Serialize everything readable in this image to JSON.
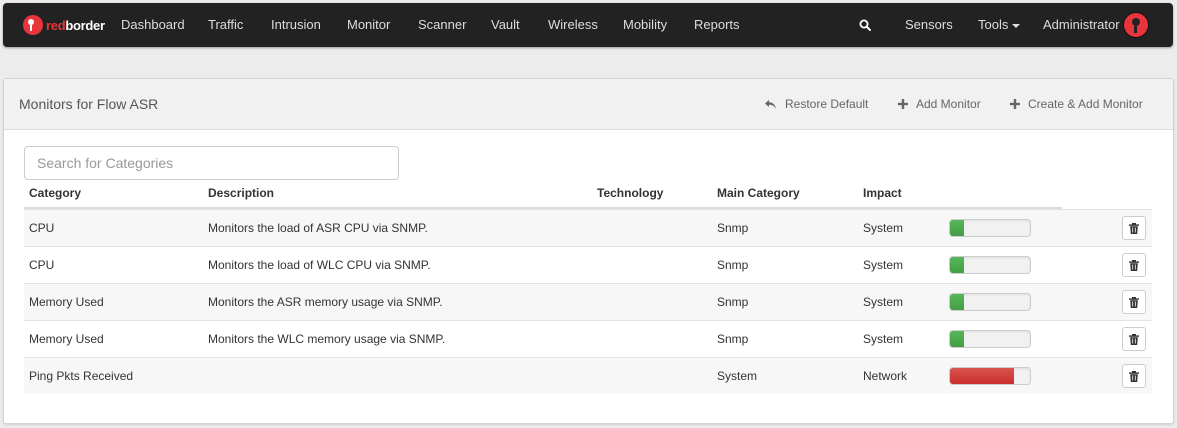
{
  "brand": {
    "red": "red",
    "white": "border"
  },
  "nav": {
    "items": [
      "Dashboard",
      "Traffic",
      "Intrusion",
      "Monitor",
      "Scanner",
      "Vault",
      "Wireless",
      "Mobility",
      "Reports"
    ],
    "search_icon": "search-icon",
    "sensors": "Sensors",
    "tools": "Tools",
    "user": "Administrator"
  },
  "panel": {
    "title": "Monitors for Flow ASR",
    "actions": {
      "restore": "Restore Default",
      "add": "Add Monitor",
      "create_add": "Create & Add Monitor"
    }
  },
  "search": {
    "placeholder": "Search for Categories",
    "value": ""
  },
  "table": {
    "headers": [
      "Category",
      "Description",
      "Technology",
      "Main Category",
      "Impact"
    ],
    "rows": [
      {
        "category": "CPU",
        "description": "Monitors the load of ASR CPU via SNMP.",
        "technology": "",
        "main_category": "Snmp",
        "impact": "System",
        "level": 0.18,
        "color": "green"
      },
      {
        "category": "CPU",
        "description": "Monitors the load of WLC CPU via SNMP.",
        "technology": "",
        "main_category": "Snmp",
        "impact": "System",
        "level": 0.18,
        "color": "green"
      },
      {
        "category": "Memory Used",
        "description": "Monitors the ASR memory usage via SNMP.",
        "technology": "",
        "main_category": "Snmp",
        "impact": "System",
        "level": 0.18,
        "color": "green"
      },
      {
        "category": "Memory Used",
        "description": "Monitors the WLC memory usage via SNMP.",
        "technology": "",
        "main_category": "Snmp",
        "impact": "System",
        "level": 0.18,
        "color": "green"
      },
      {
        "category": "Ping Pkts Received",
        "description": "",
        "technology": "",
        "main_category": "System",
        "impact": "Network",
        "level": 0.8,
        "color": "red"
      }
    ]
  },
  "colors": {
    "navbar": "#222222",
    "brand": "#e8353b",
    "green": "#5cb85c",
    "red": "#d9534f"
  }
}
